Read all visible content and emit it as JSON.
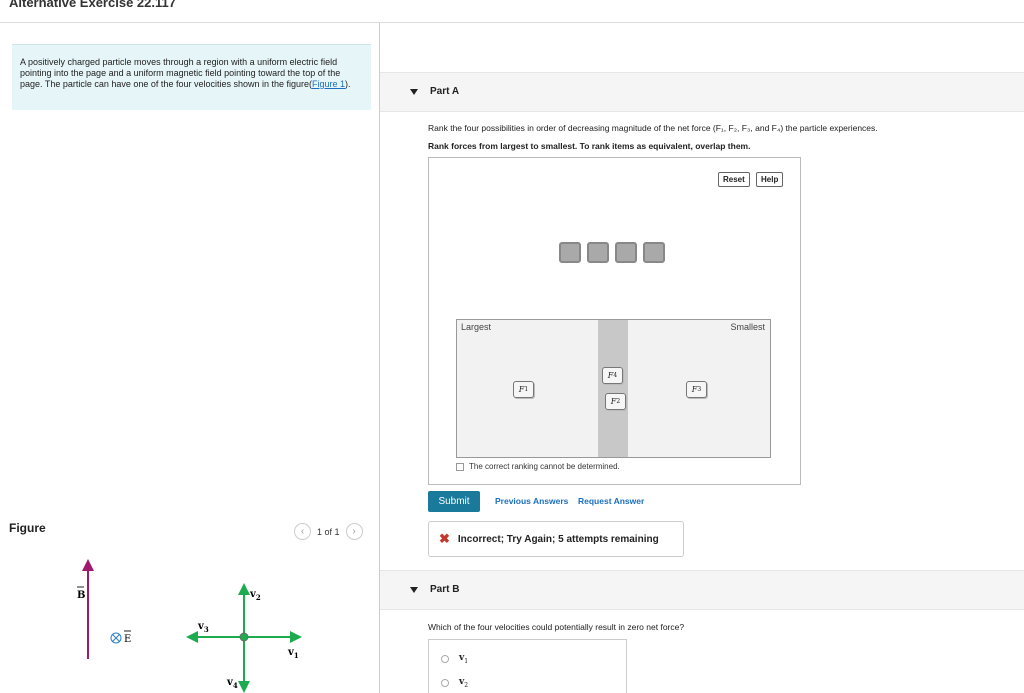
{
  "title": "Alternative Exercise 22.117",
  "problem": {
    "text": "A positively charged particle moves through a region with a uniform electric field pointing into the page and a uniform magnetic field pointing toward the top of the page. The particle can have one of the four velocities shown in the figure(",
    "link": "Figure 1",
    "tail": ")."
  },
  "figure": {
    "label": "Figure",
    "pager_text": "1 of 1",
    "prev_icon": "chevron-left-icon",
    "next_icon": "chevron-right-icon",
    "labels": {
      "B": "B",
      "E": "E",
      "v1": "v",
      "v2": "v",
      "v3": "v",
      "v4": "v",
      "s1": "1",
      "s2": "2",
      "s3": "3",
      "s4": "4"
    },
    "colors": {
      "magnetic": "#a0196e",
      "velocity": "#1eaa4e",
      "grid": "#6b6b6b"
    }
  },
  "partA": {
    "label": "Part A",
    "question": "Rank the four possibilities in order of decreasing magnitude of the net force (F₁, F₂, F₃, and F₄) the particle experiences.",
    "instruction": "Rank forces from largest to smallest. To rank items as equivalent, overlap them.",
    "reset": "Reset",
    "help": "Help",
    "largest": "Largest",
    "smallest": "Smallest",
    "tiles": {
      "f1": "F",
      "f4": "F",
      "f2": "F",
      "f3": "F",
      "s1": "1",
      "s2": "2",
      "s3": "3",
      "s4": "4"
    },
    "cannot": "The correct ranking cannot be determined.",
    "submit": "Submit",
    "previous_answers": "Previous Answers",
    "request_answer": "Request Answer",
    "feedback": "Incorrect; Try Again; 5 attempts remaining",
    "feedback_icon": "x-icon"
  },
  "partB": {
    "label": "Part B",
    "question": "Which of the four velocities could potentially result in zero net force?",
    "options": [
      {
        "v": "v",
        "sub": "1"
      },
      {
        "v": "v",
        "sub": "2"
      }
    ]
  }
}
